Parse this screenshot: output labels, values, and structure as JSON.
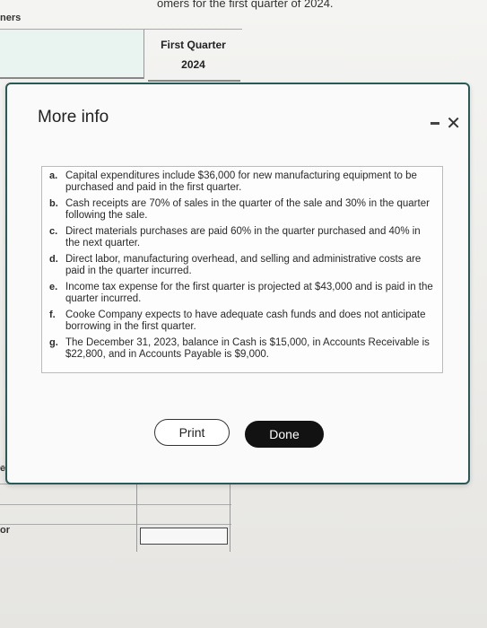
{
  "background": {
    "top_text": "omers for the first quarter of 2024.",
    "left_top_label": "ners",
    "column_header_line1": "First Quarter",
    "column_header_line2": "2024",
    "left_mid_label": "erials",
    "left_bottom_label": "or"
  },
  "modal": {
    "title": "More info",
    "minimize_label": "-",
    "close_label": "✕",
    "items": [
      {
        "letter": "a.",
        "text": "Capital expenditures include $36,000 for new manufacturing equipment to be purchased and paid in the first quarter."
      },
      {
        "letter": "b.",
        "text": "Cash receipts are 70% of sales in the quarter of the sale and 30% in the quarter following the sale."
      },
      {
        "letter": "c.",
        "text": "Direct materials purchases are paid 60% in the quarter purchased and 40% in the next quarter."
      },
      {
        "letter": "d.",
        "text": "Direct labor, manufacturing overhead, and selling and administrative costs are paid in the quarter incurred."
      },
      {
        "letter": "e.",
        "text": "Income tax expense for the first quarter is projected at $43,000 and is paid in the quarter incurred."
      },
      {
        "letter": "f.",
        "text": "Cooke Company expects to have adequate cash funds and does not anticipate borrowing in the first quarter."
      },
      {
        "letter": "g.",
        "text": "The December 31, 2023, balance in Cash is $15,000, in Accounts Receivable is $22,800, and in Accounts Payable is $9,000."
      }
    ],
    "print_label": "Print",
    "done_label": "Done"
  }
}
